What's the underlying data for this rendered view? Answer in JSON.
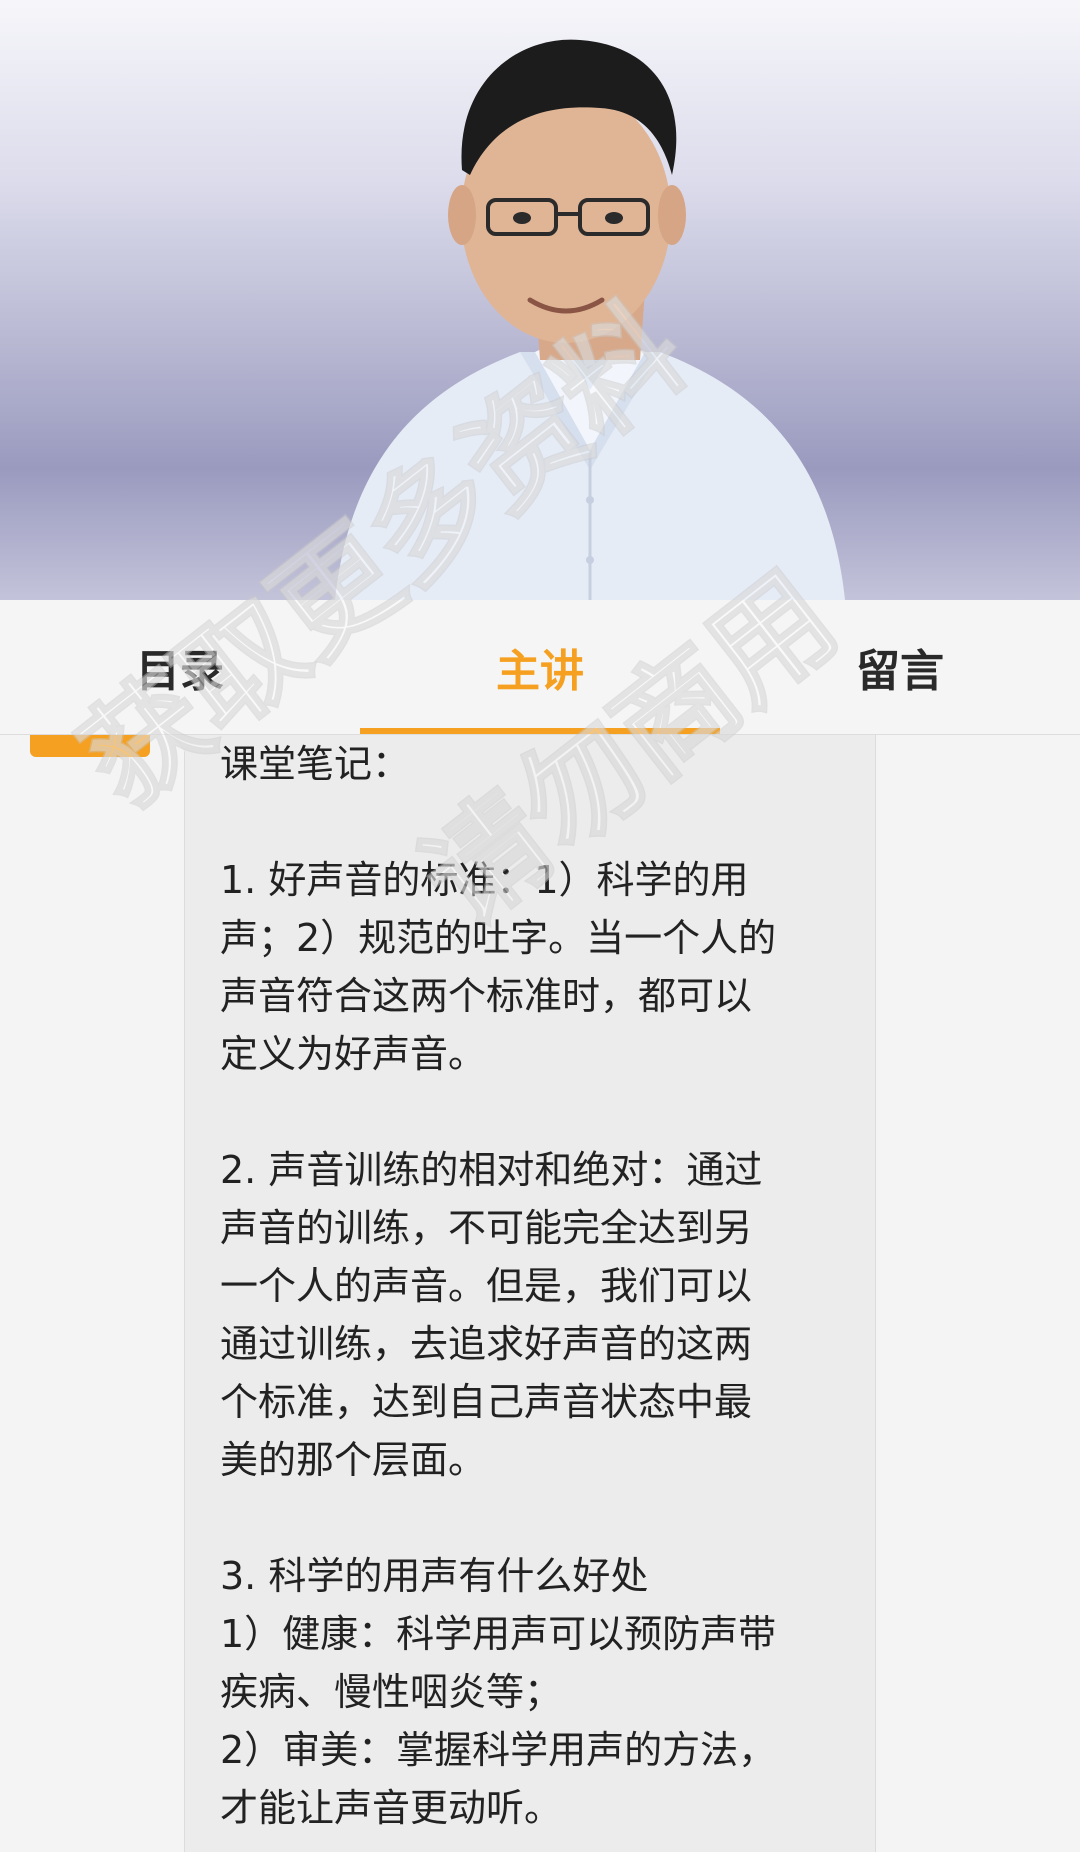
{
  "hero": {
    "image": "speaker-portrait"
  },
  "tabs": [
    {
      "label": "目录",
      "active": false
    },
    {
      "label": "主讲",
      "active": true
    },
    {
      "label": "留言",
      "active": false
    }
  ],
  "colors": {
    "accent": "#f5a020",
    "tab_bar_bg": "#f5f5f5",
    "bubble_bg": "#ececec",
    "text": "#222222"
  },
  "notes": {
    "heading": "课堂笔记：",
    "p1": [
      "1. 好声音的标准：1）科学的用",
      "声；2）规范的吐字。当一个人的",
      "声音符合这两个标准时，都可以",
      "定义为好声音。"
    ],
    "p2": [
      "2. 声音训练的相对和绝对：通过",
      "声音的训练，不可能完全达到另",
      "一个人的声音。但是，我们可以",
      "通过训练，去追求好声音的这两",
      "个标准，达到自己声音状态中最",
      "美的那个层面。"
    ],
    "p3": [
      "3. 科学的用声有什么好处",
      "1）健康：科学用声可以预防声带",
      "疾病、慢性咽炎等；",
      "2）审美：掌握科学用声的方法，",
      "才能让声音更动听。"
    ]
  },
  "watermark": {
    "line1": "获取更多资料",
    "line2": "请勿商用"
  }
}
